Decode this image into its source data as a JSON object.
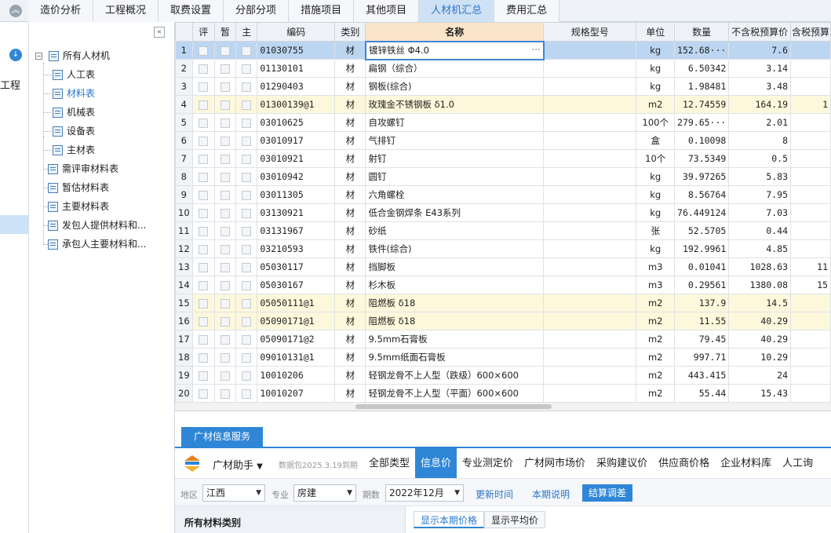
{
  "top_tabs": [
    {
      "label": "造价分析",
      "active": false
    },
    {
      "label": "工程概况",
      "active": false
    },
    {
      "label": "取费设置",
      "active": false
    },
    {
      "label": "分部分项",
      "active": false
    },
    {
      "label": "措施项目",
      "active": false
    },
    {
      "label": "其他项目",
      "active": false
    },
    {
      "label": "人材机汇总",
      "active": true
    },
    {
      "label": "费用汇总",
      "active": false
    }
  ],
  "left_strip": {
    "project_label": "工程"
  },
  "tree": {
    "root": "所有人材机",
    "children": [
      "人工表",
      "材料表",
      "机械表",
      "设备表",
      "主材表"
    ],
    "active_child": 1,
    "others": [
      "需评审材料表",
      "暂估材料表",
      "主要材料表",
      "发包人提供材料和...",
      "承包人主要材料和..."
    ]
  },
  "grid": {
    "headers": [
      "",
      "评",
      "暂",
      "主",
      "编码",
      "类别",
      "名称",
      "规格型号",
      "单位",
      "数量",
      "不含税预算价",
      "含税预算"
    ],
    "rows": [
      {
        "no": "1",
        "code": "01030755",
        "cat": "材",
        "name": "镀锌铁丝 Φ4.0",
        "spec": "",
        "unit": "kg",
        "qty": "152.68···",
        "price": "7.6",
        "tax": "",
        "state": "sel"
      },
      {
        "no": "2",
        "code": "01130101",
        "cat": "材",
        "name": "扁钢（综合）",
        "spec": "",
        "unit": "kg",
        "qty": "6.50342",
        "price": "3.14",
        "tax": "",
        "state": ""
      },
      {
        "no": "3",
        "code": "01290403",
        "cat": "材",
        "name": "钢板(综合)",
        "spec": "",
        "unit": "kg",
        "qty": "1.98481",
        "price": "3.48",
        "tax": "",
        "state": ""
      },
      {
        "no": "4",
        "code": "01300139@1",
        "cat": "材",
        "name": "玫瑰金不锈钢板 δ1.0",
        "spec": "",
        "unit": "m2",
        "qty": "12.74559",
        "price": "164.19",
        "tax": "1",
        "state": "hl"
      },
      {
        "no": "5",
        "code": "03010625",
        "cat": "材",
        "name": "自攻螺钉",
        "spec": "",
        "unit": "100个",
        "qty": "279.65···",
        "price": "2.01",
        "tax": "",
        "state": ""
      },
      {
        "no": "6",
        "code": "03010917",
        "cat": "材",
        "name": "气排钉",
        "spec": "",
        "unit": "盒",
        "qty": "0.10098",
        "price": "8",
        "tax": "",
        "state": ""
      },
      {
        "no": "7",
        "code": "03010921",
        "cat": "材",
        "name": "射钉",
        "spec": "",
        "unit": "10个",
        "qty": "73.5349",
        "price": "0.5",
        "tax": "",
        "state": ""
      },
      {
        "no": "8",
        "code": "03010942",
        "cat": "材",
        "name": "圆钉",
        "spec": "",
        "unit": "kg",
        "qty": "39.97265",
        "price": "5.83",
        "tax": "",
        "state": ""
      },
      {
        "no": "9",
        "code": "03011305",
        "cat": "材",
        "name": "六角螺栓",
        "spec": "",
        "unit": "kg",
        "qty": "8.56764",
        "price": "7.95",
        "tax": "",
        "state": ""
      },
      {
        "no": "10",
        "code": "03130921",
        "cat": "材",
        "name": "低合金钢焊条 E43系列",
        "spec": "",
        "unit": "kg",
        "qty": "76.449124",
        "price": "7.03",
        "tax": "",
        "state": ""
      },
      {
        "no": "11",
        "code": "03131967",
        "cat": "材",
        "name": "砂纸",
        "spec": "",
        "unit": "张",
        "qty": "52.5705",
        "price": "0.44",
        "tax": "",
        "state": ""
      },
      {
        "no": "12",
        "code": "03210593",
        "cat": "材",
        "name": "铁件(综合)",
        "spec": "",
        "unit": "kg",
        "qty": "192.9961",
        "price": "4.85",
        "tax": "",
        "state": ""
      },
      {
        "no": "13",
        "code": "05030117",
        "cat": "材",
        "name": "挡脚板",
        "spec": "",
        "unit": "m3",
        "qty": "0.01041",
        "price": "1028.63",
        "tax": "11",
        "state": ""
      },
      {
        "no": "14",
        "code": "05030167",
        "cat": "材",
        "name": "杉木板",
        "spec": "",
        "unit": "m3",
        "qty": "0.29561",
        "price": "1380.08",
        "tax": "15",
        "state": ""
      },
      {
        "no": "15",
        "code": "05050111@1",
        "cat": "材",
        "name": "阻燃板 δ18",
        "spec": "",
        "unit": "m2",
        "qty": "137.9",
        "price": "14.5",
        "tax": "",
        "state": "hl"
      },
      {
        "no": "16",
        "code": "05090171@1",
        "cat": "材",
        "name": "阻燃板 δ18",
        "spec": "",
        "unit": "m2",
        "qty": "11.55",
        "price": "40.29",
        "tax": "",
        "state": "hl"
      },
      {
        "no": "17",
        "code": "05090171@2",
        "cat": "材",
        "name": "9.5mm石膏板",
        "spec": "",
        "unit": "m2",
        "qty": "79.45",
        "price": "40.29",
        "tax": "",
        "state": ""
      },
      {
        "no": "18",
        "code": "09010131@1",
        "cat": "材",
        "name": "9.5mm纸面石膏板",
        "spec": "",
        "unit": "m2",
        "qty": "997.71",
        "price": "10.29",
        "tax": "",
        "state": ""
      },
      {
        "no": "19",
        "code": "10010206",
        "cat": "材",
        "name": "轻钢龙骨不上人型（跌级）600×600",
        "spec": "",
        "unit": "m2",
        "qty": "443.415",
        "price": "24",
        "tax": "",
        "state": ""
      },
      {
        "no": "20",
        "code": "10010207",
        "cat": "材",
        "name": "轻钢龙骨不上人型（平面）600×600",
        "spec": "",
        "unit": "m2",
        "qty": "55.44",
        "price": "15.43",
        "tax": "",
        "state": ""
      }
    ]
  },
  "bottom": {
    "service_tab": "广材信息服务",
    "assistant": "广材助手",
    "package_note": "数据包2025.3.19到期",
    "tabs": [
      {
        "label": "全部类型",
        "active": false
      },
      {
        "label": "信息价",
        "active": true
      },
      {
        "label": "专业测定价",
        "active": false
      },
      {
        "label": "广材网市场价",
        "active": false
      },
      {
        "label": "采购建议价",
        "active": false
      },
      {
        "label": "供应商价格",
        "active": false
      },
      {
        "label": "企业材料库",
        "active": false
      },
      {
        "label": "人工询",
        "active": false
      }
    ],
    "filters": {
      "region_label": "地区",
      "region": "江西",
      "major_label": "专业",
      "major": "房建",
      "period_label": "期数",
      "period": "2022年12月",
      "update_time": "更新时间",
      "period_note": "本期说明",
      "settle_button": "结算调差"
    },
    "category_header": "所有材料类别",
    "view_tabs": [
      {
        "label": "显示本期价格",
        "active": true
      },
      {
        "label": "显示平均价",
        "active": false
      }
    ]
  },
  "colors": {
    "accent": "#2f86d6",
    "active_tab_bg": "#cfe2f5",
    "highlight_row": "#fdf8dc",
    "selected_row": "#bcd6f2",
    "name_header": "#fbe5c9"
  }
}
